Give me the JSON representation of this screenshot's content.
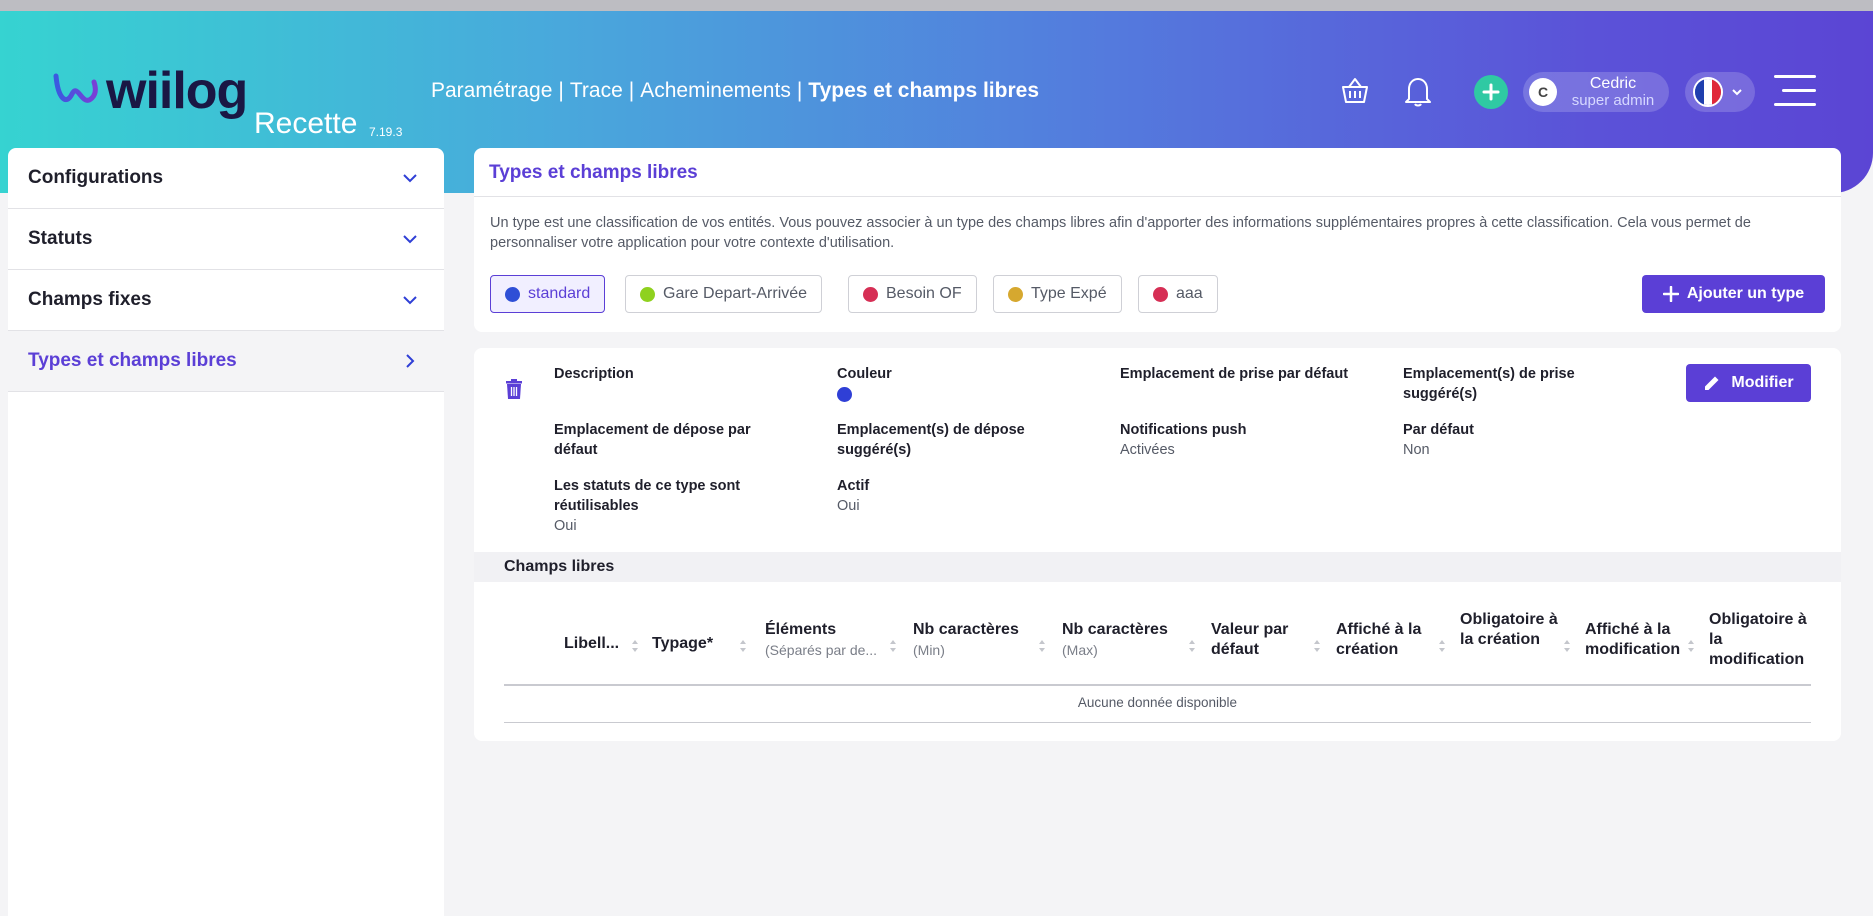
{
  "header": {
    "logo_text": "wiilog",
    "environment": "Recette",
    "version": "7.19.3",
    "breadcrumb": [
      "Paramétrage",
      "Trace",
      "Acheminements"
    ],
    "breadcrumb_current": "Types et champs libres",
    "user": {
      "initial": "C",
      "name": "Cedric",
      "role": "super admin"
    },
    "language": "fr"
  },
  "sidebar": {
    "items": [
      {
        "label": "Configurations"
      },
      {
        "label": "Statuts"
      },
      {
        "label": "Champs fixes"
      },
      {
        "label": "Types et champs libres"
      }
    ]
  },
  "types_card": {
    "title": "Types et champs libres",
    "description": "Un type est une classification de vos entités. Vous pouvez associer à un type des champs libres afin d'apporter des informations supplémentaires propres à cette classification. Cela vous permet de personnaliser votre application pour votre contexte d'utilisation.",
    "types": [
      {
        "label": "standard",
        "color": "#2f4fd6"
      },
      {
        "label": "Gare Depart-Arrivée",
        "color": "#8fd11f"
      },
      {
        "label": "Besoin OF",
        "color": "#d62f55"
      },
      {
        "label": "Type Expé",
        "color": "#d6a82f"
      },
      {
        "label": "aaa",
        "color": "#d62f55"
      }
    ],
    "add_button": "Ajouter un type"
  },
  "detail_card": {
    "modify_button": "Modifier",
    "fields": {
      "description": {
        "label": "Description",
        "value": ""
      },
      "couleur": {
        "label": "Couleur",
        "color": "#2f3fd6"
      },
      "emplacement_prise_defaut": {
        "label": "Emplacement de prise par défaut",
        "value": ""
      },
      "emplacements_prise_suggeres": {
        "label": "Emplacement(s) de prise suggéré(s)",
        "value": ""
      },
      "emplacement_depose_defaut": {
        "label": "Emplacement de dépose par défaut",
        "value": ""
      },
      "emplacements_depose_suggeres": {
        "label": "Emplacement(s) de dépose suggéré(s)",
        "value": ""
      },
      "notifications_push": {
        "label": "Notifications push",
        "value": "Activées"
      },
      "par_defaut": {
        "label": "Par défaut",
        "value": "Non"
      },
      "statuts_reutilisables": {
        "label": "Les statuts de ce type sont réutilisables",
        "value": "Oui"
      },
      "actif": {
        "label": "Actif",
        "value": "Oui"
      }
    },
    "free_fields_title": "Champs libres",
    "table": {
      "columns": [
        {
          "label": "Libell...",
          "sub": ""
        },
        {
          "label": "Typage*",
          "sub": ""
        },
        {
          "label": "Éléments",
          "sub": "(Séparés par de..."
        },
        {
          "label": "Nb caractères",
          "sub": "(Min)"
        },
        {
          "label": "Nb caractères",
          "sub": "(Max)"
        },
        {
          "label": "Valeur par défaut",
          "sub": ""
        },
        {
          "label": "Affiché à la création",
          "sub": ""
        },
        {
          "label": "Obligatoire à la création",
          "sub": ""
        },
        {
          "label": "Affiché à la modification",
          "sub": ""
        },
        {
          "label": "Obligatoire à la modification",
          "sub": ""
        }
      ],
      "empty_message": "Aucune donnée disponible"
    }
  }
}
